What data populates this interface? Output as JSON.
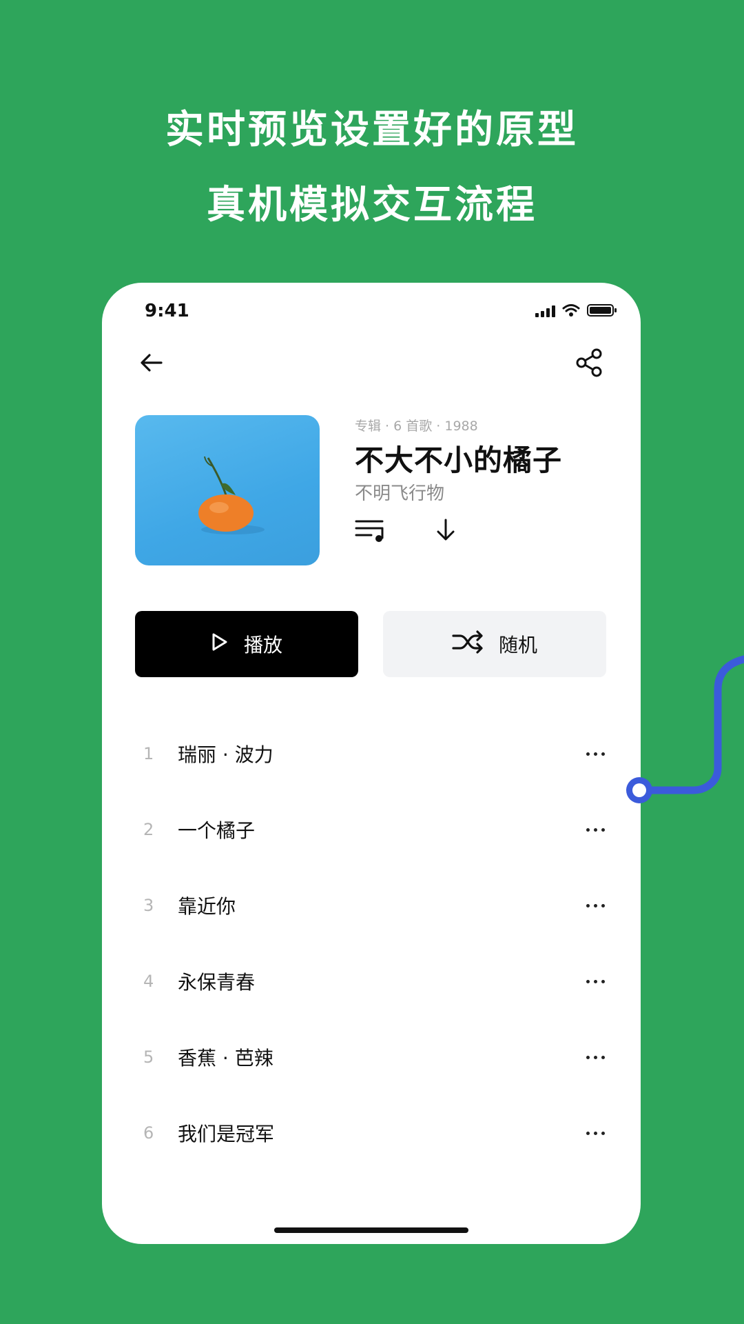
{
  "promo": {
    "line1": "实时预览设置好的原型",
    "line2": "真机模拟交互流程"
  },
  "status_bar": {
    "time": "9:41"
  },
  "album": {
    "meta": "专辑 · 6 首歌 · 1988",
    "title": "不大不小的橘子",
    "artist": "不明飞行物"
  },
  "actions": {
    "play_label": "播放",
    "shuffle_label": "随机"
  },
  "tracks": [
    {
      "number": "1",
      "title": "瑞丽 · 波力"
    },
    {
      "number": "2",
      "title": "一个橘子"
    },
    {
      "number": "3",
      "title": "靠近你"
    },
    {
      "number": "4",
      "title": "永保青春"
    },
    {
      "number": "5",
      "title": "香蕉 · 芭辣"
    },
    {
      "number": "6",
      "title": "我们是冠军"
    }
  ],
  "icons": [
    "back-arrow-icon",
    "share-icon",
    "queue-icon",
    "download-icon",
    "play-icon",
    "shuffle-icon",
    "more-icon",
    "signal-icon",
    "wifi-icon",
    "battery-icon"
  ],
  "colors": {
    "background": "#2ea55b",
    "connector": "#3b5bdb",
    "primary_button": "#000000",
    "secondary_button": "#f2f3f5"
  }
}
